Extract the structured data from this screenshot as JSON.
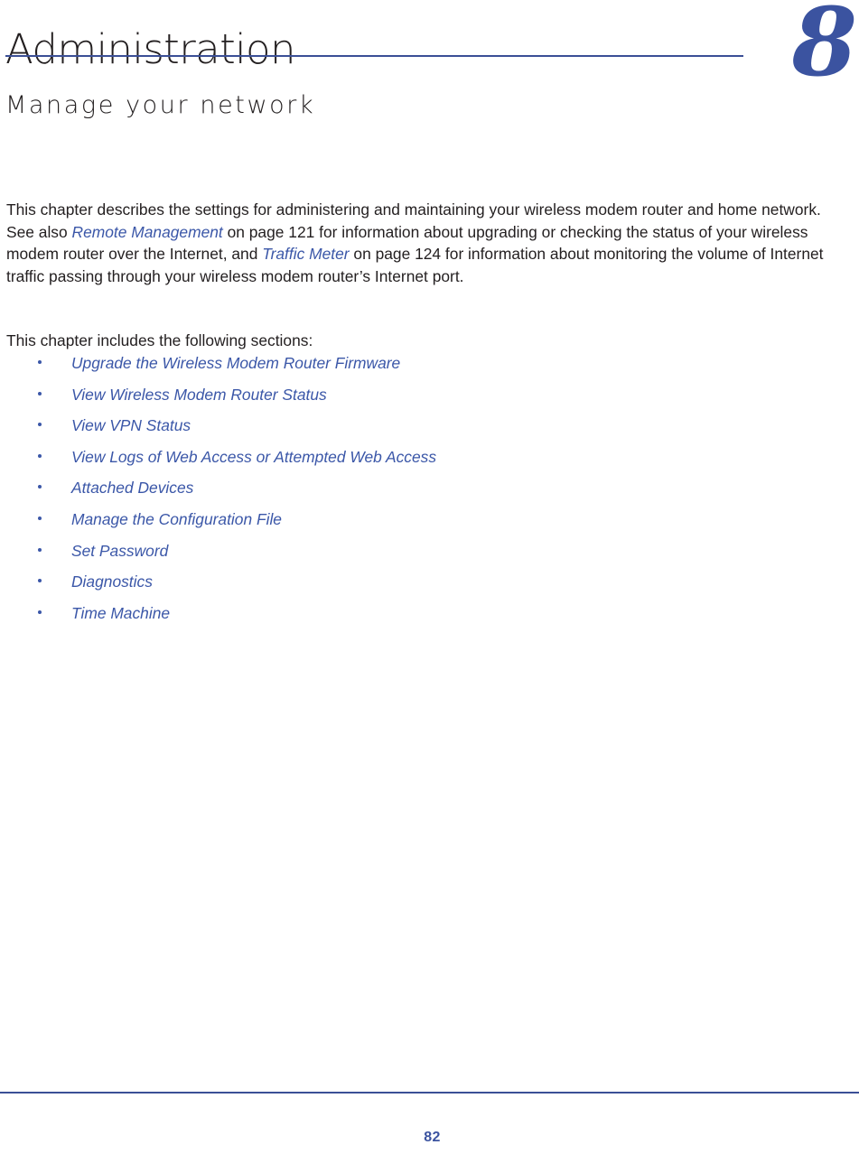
{
  "header": {
    "chapter_title": "Administration",
    "chapter_subtitle": "Manage your network",
    "chapter_number": "8",
    "rule_color": "#3b4f96",
    "number_color": "#3b53a0"
  },
  "intro": {
    "part1": "This chapter describes the settings for administering and maintaining your wireless modem router and home network. See also ",
    "xref1": "Remote Management",
    "part2": " on page 121 for information about upgrading or checking the status of your wireless modem router over the Internet, and ",
    "xref2": "Traffic Meter",
    "part3": " on page 124 for information about monitoring the volume of Internet traffic passing through your wireless modem router’s Internet port.",
    "link_color": "#3b57a8"
  },
  "sections": {
    "lead": "This chapter includes the following sections:",
    "items": [
      {
        "label": "Upgrade the Wireless Modem Router Firmware"
      },
      {
        "label": "View Wireless Modem Router Status"
      },
      {
        "label": "View VPN Status"
      },
      {
        "label": "View Logs of Web Access or Attempted Web Access"
      },
      {
        "label": "Attached Devices"
      },
      {
        "label": "Manage the Configuration File"
      },
      {
        "label": "Set Password"
      },
      {
        "label": "Diagnostics"
      },
      {
        "label": "Time Machine"
      }
    ]
  },
  "footer": {
    "page_number": "82"
  }
}
